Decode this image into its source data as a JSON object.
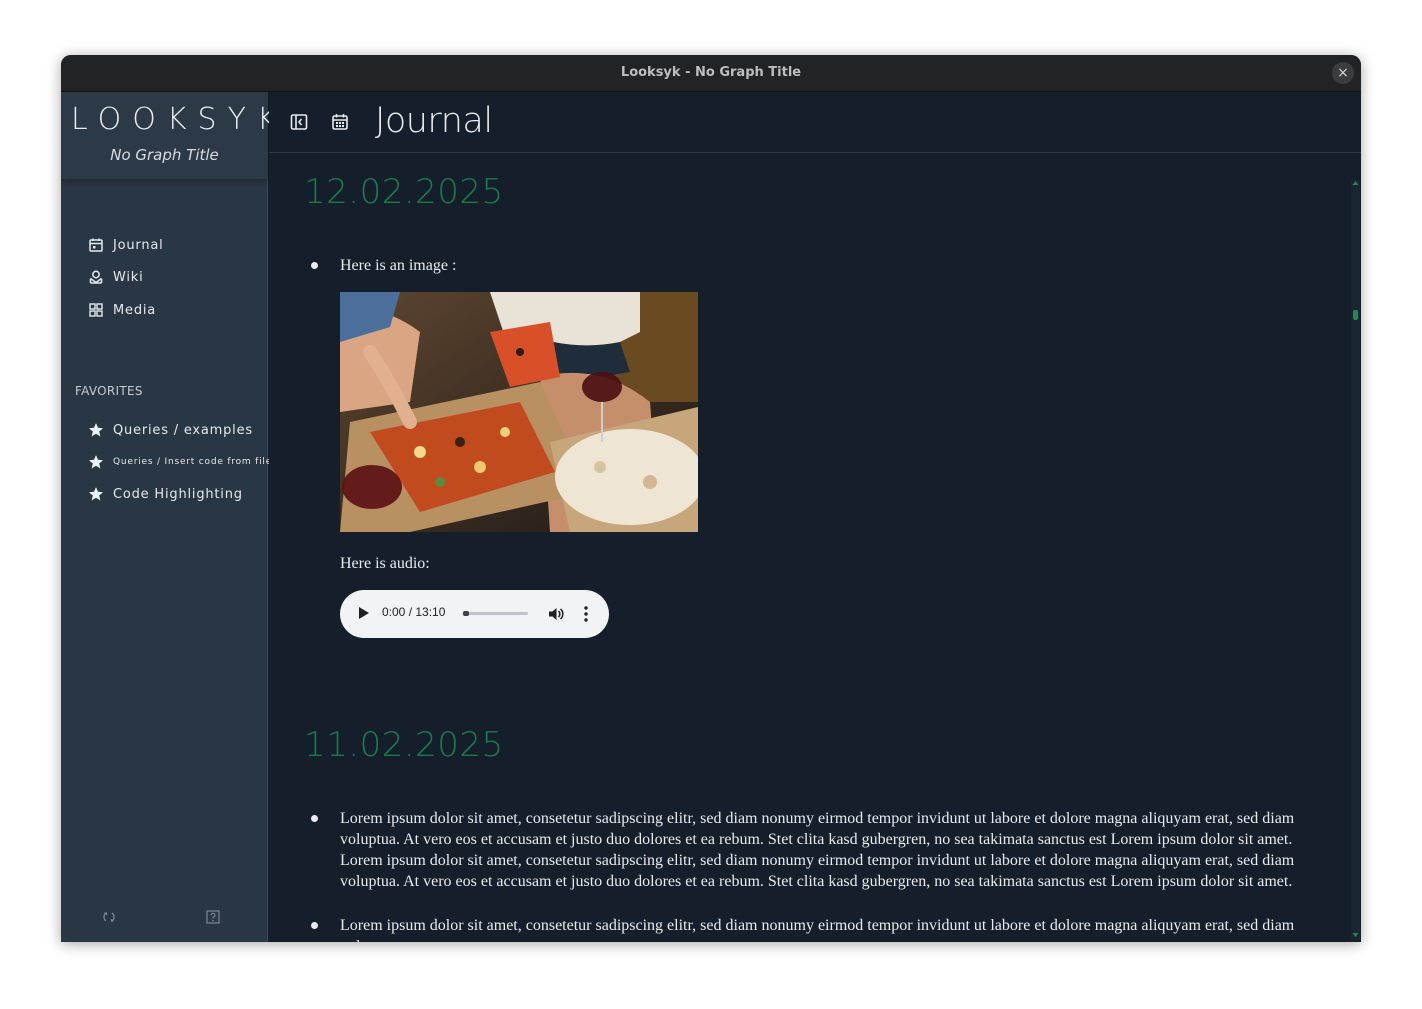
{
  "window": {
    "title": "Looksyk - No Graph Title",
    "close_glyph": "×"
  },
  "sidebar": {
    "brand": "LOOKSYK",
    "graph_title": "No Graph Title",
    "nav": [
      {
        "label": "Journal",
        "icon": "calendar-icon"
      },
      {
        "label": "Wiki",
        "icon": "wiki-icon"
      },
      {
        "label": "Media",
        "icon": "grid-icon"
      }
    ],
    "favorites_title": "FAVORITES",
    "favorites": [
      {
        "label": "Queries / examples",
        "icon": "star-icon"
      },
      {
        "label": "Queries / Insert code from file",
        "icon": "star-icon"
      },
      {
        "label": "Code Highlighting",
        "icon": "star-icon"
      }
    ],
    "bottom_icons": [
      "sync-icon",
      "help-icon"
    ]
  },
  "header": {
    "title": "Journal",
    "icons": [
      "sidebar-toggle-icon",
      "calendar-icon"
    ]
  },
  "journal": {
    "entries": [
      {
        "date": "12.02.2025",
        "image_caption": "Here is an image :",
        "audio_caption": "Here is audio:",
        "audio": {
          "time": "0:00 / 13:10",
          "progress": 0.02
        }
      },
      {
        "date": "11.02.2025",
        "paragraphs": [
          "Lorem ipsum dolor sit amet, consetetur sadipscing elitr, sed diam nonumy eirmod tempor invidunt ut labore et dolore magna aliquyam erat, sed diam voluptua. At vero eos et accusam et justo duo dolores et ea rebum. Stet clita kasd gubergren, no sea takimata sanctus est Lorem ipsum dolor sit amet. Lorem ipsum dolor sit amet, consetetur sadipscing elitr, sed diam nonumy eirmod tempor invidunt ut labore et dolore magna aliquyam erat, sed diam voluptua. At vero eos et accusam et justo duo dolores et ea rebum. Stet clita kasd gubergren, no sea takimata sanctus est Lorem ipsum dolor sit amet.",
          "Lorem ipsum dolor sit amet, consetetur sadipscing elitr, sed diam nonumy eirmod tempor invidunt ut labore et dolore magna aliquyam erat, sed diam voluptua."
        ]
      }
    ]
  },
  "colors": {
    "accent": "#1b7a4c",
    "sidebar": "#293643",
    "main": "#141f2b"
  }
}
